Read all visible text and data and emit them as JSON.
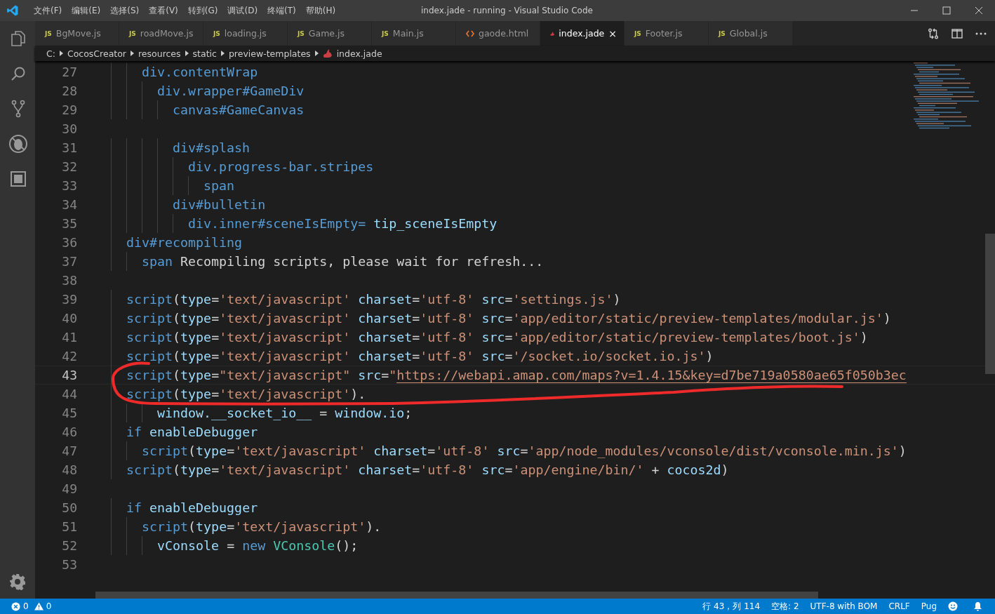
{
  "window": {
    "title": "index.jade - running - Visual Studio Code"
  },
  "menu": [
    "文件(F)",
    "编辑(E)",
    "选择(S)",
    "查看(V)",
    "转到(G)",
    "调试(D)",
    "终端(T)",
    "帮助(H)"
  ],
  "activity_bar": [
    {
      "kind": "files",
      "selected": false
    },
    {
      "kind": "search",
      "selected": false
    },
    {
      "kind": "source-control",
      "selected": false
    },
    {
      "kind": "debug",
      "selected": false
    },
    {
      "kind": "extensions",
      "selected": false
    }
  ],
  "tabs": [
    {
      "label": "BgMove.js",
      "kind": "js",
      "badge": "JS",
      "selected": false
    },
    {
      "label": "roadMove.js",
      "kind": "js",
      "badge": "JS",
      "selected": false
    },
    {
      "label": "loading.js",
      "kind": "js",
      "badge": "JS",
      "selected": false
    },
    {
      "label": "Game.js",
      "kind": "js",
      "badge": "JS",
      "selected": false
    },
    {
      "label": "Main.js",
      "kind": "js",
      "badge": "JS",
      "selected": false
    },
    {
      "label": "gaode.html",
      "kind": "html",
      "selected": false
    },
    {
      "label": "index.jade",
      "kind": "jade",
      "selected": true,
      "close": "×"
    },
    {
      "label": "Footer.js",
      "kind": "js",
      "badge": "JS",
      "selected": false
    },
    {
      "label": "Global.js",
      "kind": "js",
      "badge": "JS",
      "selected": false
    }
  ],
  "breadcrumb": [
    {
      "label": "C:",
      "kind": "folder"
    },
    {
      "label": "CocosCreator",
      "kind": "folder"
    },
    {
      "label": "resources",
      "kind": "folder"
    },
    {
      "label": "static",
      "kind": "folder"
    },
    {
      "label": "preview-templates",
      "kind": "folder"
    },
    {
      "label": "index.jade",
      "kind": "jade"
    }
  ],
  "editor": {
    "lines": [
      {
        "number": "27",
        "current": false,
        "tokens": [
          {
            "kind": "tag",
            "text": "      div.contentWrap"
          }
        ]
      },
      {
        "number": "28",
        "current": false,
        "tokens": [
          {
            "kind": "tag",
            "text": "        div.wrapper#GameDiv"
          }
        ]
      },
      {
        "number": "29",
        "current": false,
        "tokens": [
          {
            "kind": "tag",
            "text": "          canvas#GameCanvas"
          }
        ]
      },
      {
        "number": "30",
        "current": false
      },
      {
        "number": "31",
        "current": false,
        "tokens": [
          {
            "kind": "tag",
            "text": "          div#splash"
          }
        ]
      },
      {
        "number": "32",
        "current": false,
        "tokens": [
          {
            "kind": "tag",
            "text": "            div.progress-bar.stripes"
          }
        ]
      },
      {
        "number": "33",
        "current": false,
        "tokens": [
          {
            "kind": "tag",
            "text": "              span"
          }
        ]
      },
      {
        "number": "34",
        "current": false,
        "tokens": [
          {
            "kind": "tag",
            "text": "          div#bulletin"
          }
        ]
      },
      {
        "number": "35",
        "current": false,
        "tokens": [
          {
            "kind": "tag",
            "text": "            div.inner#sceneIsEmpty="
          },
          {
            "kind": "var",
            "text": " tip_sceneIsEmpty"
          }
        ]
      },
      {
        "number": "36",
        "current": false,
        "tokens": [
          {
            "kind": "tag",
            "text": "    div#recompiling"
          }
        ]
      },
      {
        "number": "37",
        "current": false,
        "tokens": [
          {
            "kind": "tag",
            "text": "      span"
          },
          {
            "kind": "text",
            "text": " Recompiling scripts, please wait for refresh..."
          }
        ]
      },
      {
        "number": "38",
        "current": false
      },
      {
        "number": "39",
        "current": false,
        "tokens": [
          {
            "kind": "tag",
            "text": "    script"
          },
          {
            "kind": "punc",
            "text": "("
          },
          {
            "kind": "attr",
            "text": "type"
          },
          {
            "kind": "punc",
            "text": "="
          },
          {
            "kind": "str",
            "text": "'text/javascript'"
          },
          {
            "kind": "attr",
            "text": " charset"
          },
          {
            "kind": "punc",
            "text": "="
          },
          {
            "kind": "str",
            "text": "'utf-8'"
          },
          {
            "kind": "attr",
            "text": " src"
          },
          {
            "kind": "punc",
            "text": "="
          },
          {
            "kind": "str",
            "text": "'settings.js'"
          },
          {
            "kind": "punc",
            "text": ")"
          }
        ]
      },
      {
        "number": "40",
        "current": false,
        "tokens": [
          {
            "kind": "tag",
            "text": "    script"
          },
          {
            "kind": "punc",
            "text": "("
          },
          {
            "kind": "attr",
            "text": "type"
          },
          {
            "kind": "punc",
            "text": "="
          },
          {
            "kind": "str",
            "text": "'text/javascript'"
          },
          {
            "kind": "attr",
            "text": " charset"
          },
          {
            "kind": "punc",
            "text": "="
          },
          {
            "kind": "str",
            "text": "'utf-8'"
          },
          {
            "kind": "attr",
            "text": " src"
          },
          {
            "kind": "punc",
            "text": "="
          },
          {
            "kind": "str",
            "text": "'app/editor/static/preview-templates/modular.js'"
          },
          {
            "kind": "punc",
            "text": ")"
          }
        ]
      },
      {
        "number": "41",
        "current": false,
        "tokens": [
          {
            "kind": "tag",
            "text": "    script"
          },
          {
            "kind": "punc",
            "text": "("
          },
          {
            "kind": "attr",
            "text": "type"
          },
          {
            "kind": "punc",
            "text": "="
          },
          {
            "kind": "str",
            "text": "'text/javascript'"
          },
          {
            "kind": "attr",
            "text": " charset"
          },
          {
            "kind": "punc",
            "text": "="
          },
          {
            "kind": "str",
            "text": "'utf-8'"
          },
          {
            "kind": "attr",
            "text": " src"
          },
          {
            "kind": "punc",
            "text": "="
          },
          {
            "kind": "str",
            "text": "'app/editor/static/preview-templates/boot.js'"
          },
          {
            "kind": "punc",
            "text": ")"
          }
        ]
      },
      {
        "number": "42",
        "current": false,
        "tokens": [
          {
            "kind": "tag",
            "text": "    script"
          },
          {
            "kind": "punc",
            "text": "("
          },
          {
            "kind": "attr",
            "text": "type"
          },
          {
            "kind": "punc",
            "text": "="
          },
          {
            "kind": "str",
            "text": "'text/javascript'"
          },
          {
            "kind": "attr",
            "text": " charset"
          },
          {
            "kind": "punc",
            "text": "="
          },
          {
            "kind": "str",
            "text": "'utf-8'"
          },
          {
            "kind": "attr",
            "text": " src"
          },
          {
            "kind": "punc",
            "text": "="
          },
          {
            "kind": "str",
            "text": "'/socket.io/socket.io.js'"
          },
          {
            "kind": "punc",
            "text": ")"
          }
        ]
      },
      {
        "number": "43",
        "current": true,
        "tokens": [
          {
            "kind": "tag",
            "text": "    script"
          },
          {
            "kind": "punc",
            "text": "("
          },
          {
            "kind": "attr",
            "text": "type"
          },
          {
            "kind": "punc",
            "text": "="
          },
          {
            "kind": "str",
            "text": "\"text/javascript\""
          },
          {
            "kind": "attr",
            "text": " src"
          },
          {
            "kind": "punc",
            "text": "="
          },
          {
            "kind": "str",
            "text": "\""
          },
          {
            "kind": "link",
            "text": "https://webapi.amap.com/maps?v=1.4.15&key=d7be719a0580ae65f050b3ec"
          }
        ]
      },
      {
        "number": "44",
        "current": false,
        "tokens": [
          {
            "kind": "tag",
            "text": "    script"
          },
          {
            "kind": "punc",
            "text": "("
          },
          {
            "kind": "attr",
            "text": "type"
          },
          {
            "kind": "punc",
            "text": "="
          },
          {
            "kind": "str",
            "text": "'text/javascript'"
          },
          {
            "kind": "punc",
            "text": ")."
          }
        ]
      },
      {
        "number": "45",
        "current": false,
        "tokens": [
          {
            "kind": "var",
            "text": "        window.__socket_io__"
          },
          {
            "kind": "punc",
            "text": " = "
          },
          {
            "kind": "var",
            "text": "window.io"
          },
          {
            "kind": "punc",
            "text": ";"
          }
        ]
      },
      {
        "number": "46",
        "current": false,
        "tokens": [
          {
            "kind": "kw",
            "text": "    if"
          },
          {
            "kind": "var",
            "text": " enableDebugger"
          }
        ]
      },
      {
        "number": "47",
        "current": false,
        "tokens": [
          {
            "kind": "tag",
            "text": "      script"
          },
          {
            "kind": "punc",
            "text": "("
          },
          {
            "kind": "attr",
            "text": "type"
          },
          {
            "kind": "punc",
            "text": "="
          },
          {
            "kind": "str",
            "text": "'text/javascript'"
          },
          {
            "kind": "attr",
            "text": " charset"
          },
          {
            "kind": "punc",
            "text": "="
          },
          {
            "kind": "str",
            "text": "'utf-8'"
          },
          {
            "kind": "attr",
            "text": " src"
          },
          {
            "kind": "punc",
            "text": "="
          },
          {
            "kind": "str",
            "text": "'app/node_modules/vconsole/dist/vconsole.min.js'"
          },
          {
            "kind": "punc",
            "text": ")"
          }
        ]
      },
      {
        "number": "48",
        "current": false,
        "tokens": [
          {
            "kind": "tag",
            "text": "    script"
          },
          {
            "kind": "punc",
            "text": "("
          },
          {
            "kind": "attr",
            "text": "type"
          },
          {
            "kind": "punc",
            "text": "="
          },
          {
            "kind": "str",
            "text": "'text/javascript'"
          },
          {
            "kind": "attr",
            "text": " charset"
          },
          {
            "kind": "punc",
            "text": "="
          },
          {
            "kind": "str",
            "text": "'utf-8'"
          },
          {
            "kind": "attr",
            "text": " src"
          },
          {
            "kind": "punc",
            "text": "="
          },
          {
            "kind": "str",
            "text": "'app/engine/bin/'"
          },
          {
            "kind": "punc",
            "text": " + "
          },
          {
            "kind": "var",
            "text": "cocos2d"
          },
          {
            "kind": "punc",
            "text": ")"
          }
        ]
      },
      {
        "number": "49",
        "current": false
      },
      {
        "number": "50",
        "current": false,
        "tokens": [
          {
            "kind": "kw",
            "text": "    if"
          },
          {
            "kind": "var",
            "text": " enableDebugger"
          }
        ]
      },
      {
        "number": "51",
        "current": false,
        "tokens": [
          {
            "kind": "tag",
            "text": "      script"
          },
          {
            "kind": "punc",
            "text": "("
          },
          {
            "kind": "attr",
            "text": "type"
          },
          {
            "kind": "punc",
            "text": "="
          },
          {
            "kind": "str",
            "text": "'text/javascript'"
          },
          {
            "kind": "punc",
            "text": ")."
          }
        ]
      },
      {
        "number": "52",
        "current": false,
        "tokens": [
          {
            "kind": "var",
            "text": "        vConsole"
          },
          {
            "kind": "punc",
            "text": " = "
          },
          {
            "kind": "kw",
            "text": "new"
          },
          {
            "kind": "cls",
            "text": " VConsole"
          },
          {
            "kind": "punc",
            "text": "();"
          }
        ]
      },
      {
        "number": "53",
        "current": false
      }
    ]
  },
  "status_bar": {
    "errors": "0",
    "warnings": "0",
    "items": [
      "行 43，列 114",
      "空格: 2",
      "UTF-8 with BOM",
      "CRLF",
      "Pug"
    ]
  }
}
